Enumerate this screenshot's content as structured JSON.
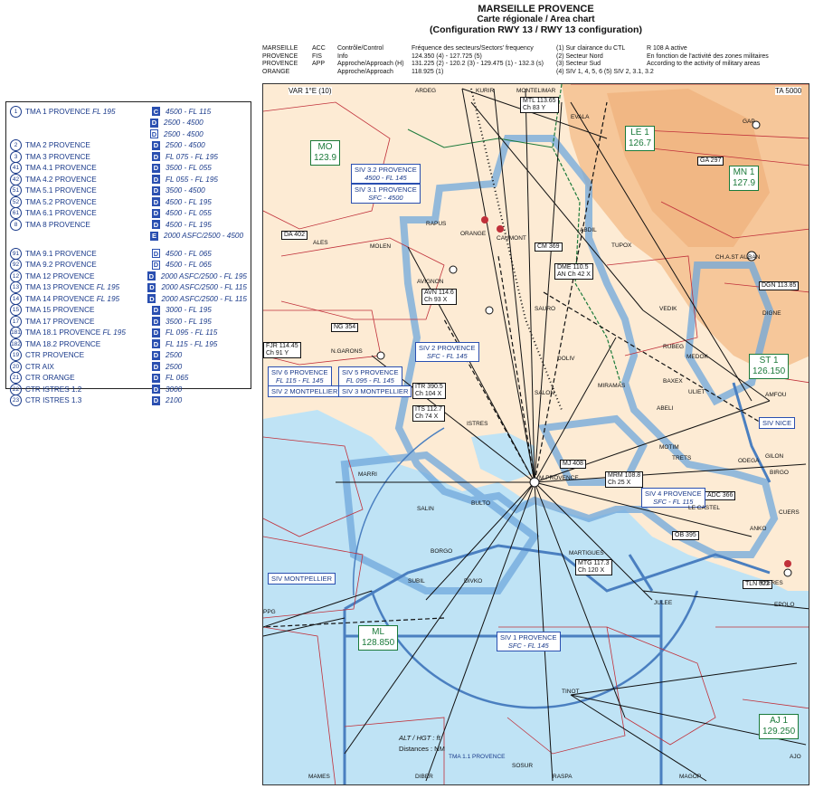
{
  "legend": [
    {
      "num": "1",
      "name": "TMA 1 PROVENCE",
      "fl": "FL 195",
      "cls": "C",
      "lim": "4500 - FL 115"
    },
    {
      "num": "",
      "name": "",
      "fl": "",
      "cls": "D",
      "lim": "2500 - 4500"
    },
    {
      "num": "",
      "name": "",
      "fl": "",
      "cls": "D",
      "lim": "2500 - 4500",
      "light": true
    },
    {
      "num": "2",
      "name": "TMA 2 PROVENCE",
      "fl": "",
      "cls": "D",
      "lim": "2500 - 4500",
      "gap": false
    },
    {
      "num": "3",
      "name": "TMA 3 PROVENCE",
      "fl": "",
      "cls": "D",
      "lim": "FL 075 - FL 195"
    },
    {
      "num": "41",
      "name": "TMA 4.1 PROVENCE",
      "fl": "",
      "cls": "D",
      "lim": "3500 - FL 055"
    },
    {
      "num": "42",
      "name": "TMA 4.2 PROVENCE",
      "fl": "",
      "cls": "D",
      "lim": "FL 055 - FL 195"
    },
    {
      "num": "51",
      "name": "TMA 5.1 PROVENCE",
      "fl": "",
      "cls": "D",
      "lim": "3500 - 4500"
    },
    {
      "num": "52",
      "name": "TMA 5.2 PROVENCE",
      "fl": "",
      "cls": "D",
      "lim": "4500 - FL 195"
    },
    {
      "num": "61",
      "name": "TMA 6.1 PROVENCE",
      "fl": "",
      "cls": "D",
      "lim": "4500 - FL 055"
    },
    {
      "num": "8",
      "name": "TMA 8 PROVENCE",
      "fl": "",
      "cls": "D",
      "lim": "4500 - FL 195"
    },
    {
      "num": "",
      "name": "",
      "fl": "",
      "cls": "E",
      "lim": "2000 ASFC/2500 - 4500"
    },
    {
      "num": "91",
      "name": "TMA 9.1 PROVENCE",
      "fl": "",
      "cls": "D",
      "lim": "4500 - FL 065",
      "light": true,
      "gap": true
    },
    {
      "num": "92",
      "name": "TMA 9.2 PROVENCE",
      "fl": "",
      "cls": "D",
      "lim": "4500 - FL 065",
      "light": true
    },
    {
      "num": "12",
      "name": "TMA 12 PROVENCE",
      "fl": "",
      "cls": "D",
      "lim": "2000 ASFC/2500 - FL 195"
    },
    {
      "num": "13",
      "name": "TMA 13 PROVENCE",
      "fl": "FL 195",
      "cls": "D",
      "lim": "2000 ASFC/2500 - FL 115"
    },
    {
      "num": "14",
      "name": "TMA 14 PROVENCE",
      "fl": "FL 195",
      "cls": "D",
      "lim": "2000 ASFC/2500 - FL 115"
    },
    {
      "num": "15",
      "name": "TMA 15 PROVENCE",
      "fl": "",
      "cls": "D",
      "lim": "3000 - FL 195"
    },
    {
      "num": "17",
      "name": "TMA 17 PROVENCE",
      "fl": "",
      "cls": "D",
      "lim": "3500 - FL 195"
    },
    {
      "num": "181",
      "name": "TMA 18.1 PROVENCE",
      "fl": "FL 195",
      "cls": "D",
      "lim": "FL 095 - FL 115"
    },
    {
      "num": "182",
      "name": "TMA 18.2 PROVENCE",
      "fl": "",
      "cls": "D",
      "lim": "FL 115 - FL 195"
    },
    {
      "num": "19",
      "name": "CTR PROVENCE",
      "fl": "",
      "cls": "D",
      "lim": "2500"
    },
    {
      "num": "20",
      "name": "CTR AIX",
      "fl": "",
      "cls": "D",
      "lim": "2500"
    },
    {
      "num": "21",
      "name": "CTR ORANGE",
      "fl": "",
      "cls": "D",
      "lim": "FL 065"
    },
    {
      "num": "22",
      "name": "CTR ISTRES 1.2",
      "fl": "",
      "cls": "D",
      "lim": "3000"
    },
    {
      "num": "23",
      "name": "CTR ISTRES 1.3",
      "fl": "",
      "cls": "D",
      "lim": "2100"
    }
  ],
  "title": {
    "line1": "MARSEILLE PROVENCE",
    "line2": "Carte régionale / Area chart",
    "line3": "(Configuration RWY 13 / RWY 13 configuration)"
  },
  "freq_table": [
    [
      "MARSEILLE",
      "ACC",
      "Contrôle/Control",
      "Fréquence des secteurs/Sectors' frequency",
      "(1) Sur clairance du CTL",
      "R 108 A active"
    ],
    [
      "PROVENCE",
      "FIS",
      "Info",
      "124.350 (4) - 127.725 (5)",
      "(2) Secteur Nord",
      "En fonction de l'activité des zones militaires"
    ],
    [
      "PROVENCE",
      "APP",
      "Approche/Approach (H)",
      "131.225 (2) - 120.2 (3) - 129.475 (1) - 132.3 (s)",
      "(3) Secteur Sud",
      "According to the activity of military areas"
    ],
    [
      "ORANGE",
      "",
      "Approche/Approach",
      "118.925 (1)",
      "(4) SIV 1, 4, 5, 6   (5) SIV 2, 3.1, 3.2",
      ""
    ]
  ],
  "map": {
    "var": "VAR 1°E (10)",
    "ta": "TA 5000",
    "controllers": [
      {
        "id": "MO",
        "freq": "123.9"
      },
      {
        "id": "LE 1",
        "freq": "126.7"
      },
      {
        "id": "MN 1",
        "freq": "127.9"
      },
      {
        "id": "ST 1",
        "freq": "126.150"
      },
      {
        "id": "ML",
        "freq": "128.850"
      },
      {
        "id": "AJ 1",
        "freq": "129.250"
      }
    ],
    "navaids": [
      {
        "name": "MTL 113.65",
        "ch": "Ch 83 Y"
      },
      {
        "name": "DA 402",
        "ch": ""
      },
      {
        "name": "CM 369",
        "ch": ""
      },
      {
        "name": "DME 110.5",
        "ch": "AN Ch 42 X"
      },
      {
        "name": "AVN 114.6",
        "ch": "Ch 93 X"
      },
      {
        "name": "NG 354",
        "ch": ""
      },
      {
        "name": "FJR 114.45",
        "ch": "Ch 91 Y"
      },
      {
        "name": "ITR 390.5",
        "ch": "Ch 104 X"
      },
      {
        "name": "ITS 112.7",
        "ch": "Ch 74 X"
      },
      {
        "name": "GA 297",
        "ch": ""
      },
      {
        "name": "DGN 113.85",
        "ch": ""
      },
      {
        "name": "MRM 108.8",
        "ch": "Ch 25 X"
      },
      {
        "name": "ADC 366",
        "ch": ""
      },
      {
        "name": "OB 395",
        "ch": ""
      },
      {
        "name": "MTG 117.3",
        "ch": "Ch 120 X"
      },
      {
        "name": "TLN 322",
        "ch": ""
      },
      {
        "name": "MJ 408",
        "ch": ""
      }
    ],
    "siv": [
      {
        "name": "SIV 3.2 PROVENCE",
        "lim": "4500 - FL 145"
      },
      {
        "name": "SIV 3.1 PROVENCE",
        "lim": "SFC - 4500"
      },
      {
        "name": "SIV 2 PROVENCE",
        "lim": "SFC - FL 145"
      },
      {
        "name": "SIV 6 PROVENCE",
        "lim": "FL 115 - FL 145"
      },
      {
        "name": "SIV 5 PROVENCE",
        "lim": "FL 095 - FL 145"
      },
      {
        "name": "SIV 2 MONTPELLIER",
        "lim": ""
      },
      {
        "name": "SIV 3 MONTPELLIER",
        "lim": ""
      },
      {
        "name": "SIV 4 PROVENCE",
        "lim": "SFC - FL 115"
      },
      {
        "name": "SIV 1 PROVENCE",
        "lim": "SFC - FL 145"
      },
      {
        "name": "SIV NICE",
        "lim": ""
      },
      {
        "name": "SIV MONTPELLIER",
        "lim": ""
      }
    ],
    "places": [
      "ARDEG",
      "KURIR",
      "MONTELIMAR",
      "EVALA",
      "GAP",
      "ALES",
      "MOLEN",
      "RAPUS",
      "ORANGE",
      "CAUMONT",
      "ABDIL",
      "TUPOX",
      "CH.A.ST AUBAN",
      "AVIGNON",
      "SAURO",
      "VEDIK",
      "MEDOK",
      "N.GARONS",
      "DOLIV",
      "SALON",
      "RUBEG",
      "BAXEX",
      "ULIET",
      "AMFOU",
      "ABELI",
      "MIRAMAS",
      "ISTRES",
      "GILON",
      "MOTIM",
      "TRETS",
      "ODEGA",
      "BIRGO",
      "MARRI",
      "M.PROVENCE",
      "SALIN",
      "BULTO",
      "LE CASTEL",
      "CUERS",
      "ANKO",
      "BORGO",
      "SUBIL",
      "DIVKO",
      "MARTIGUES",
      "JULEE",
      "HYERES",
      "EPOLO",
      "PPG",
      "TINOT",
      "SOSUR",
      "MAMES",
      "DIBER",
      "RASPA",
      "MAGOP",
      "AJO",
      "DIGNE"
    ],
    "footnote_1": "ALT / HGT : ft",
    "footnote_2": "Distances : NM",
    "tma_label": "TMA 1.1 PROVENCE",
    "colors": {
      "land": "#fbe0c0",
      "sea": "#bfe3f5",
      "tma": "#6fa8dc",
      "zone_red": "#c0303a",
      "ctrl_green": "#1b7a3a"
    }
  }
}
